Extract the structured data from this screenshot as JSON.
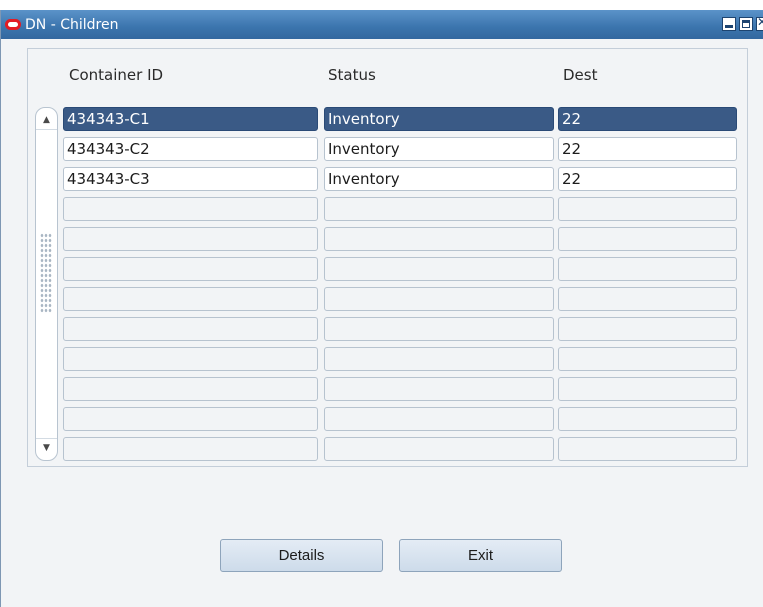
{
  "window": {
    "title": "DN - Children"
  },
  "columns": {
    "container_id": "Container ID",
    "status": "Status",
    "dest": "Dest"
  },
  "rows": [
    {
      "container_id": "434343-C1",
      "status": "Inventory",
      "dest": "22"
    },
    {
      "container_id": "434343-C2",
      "status": "Inventory",
      "dest": "22"
    },
    {
      "container_id": "434343-C3",
      "status": "Inventory",
      "dest": "22"
    },
    {
      "container_id": "",
      "status": "",
      "dest": ""
    },
    {
      "container_id": "",
      "status": "",
      "dest": ""
    },
    {
      "container_id": "",
      "status": "",
      "dest": ""
    },
    {
      "container_id": "",
      "status": "",
      "dest": ""
    },
    {
      "container_id": "",
      "status": "",
      "dest": ""
    },
    {
      "container_id": "",
      "status": "",
      "dest": ""
    },
    {
      "container_id": "",
      "status": "",
      "dest": ""
    },
    {
      "container_id": "",
      "status": "",
      "dest": ""
    },
    {
      "container_id": "",
      "status": "",
      "dest": ""
    }
  ],
  "selected_row": 0,
  "buttons": {
    "details": "Details",
    "exit": "Exit"
  },
  "icons": {
    "app": "oracle-logo-icon",
    "scroll_up": "scroll-up-arrow-icon",
    "scroll_down": "scroll-down-arrow-icon"
  },
  "colors": {
    "title_bar": "#3b74ad",
    "selected_row": "#3a5a86",
    "background": "#f2f4f6"
  }
}
